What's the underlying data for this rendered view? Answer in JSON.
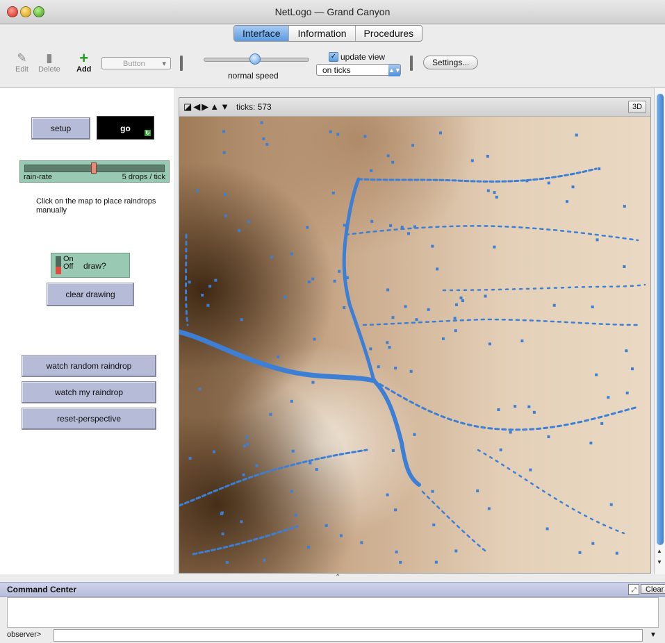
{
  "window": {
    "title": "NetLogo — Grand Canyon"
  },
  "tabs": [
    "Interface",
    "Information",
    "Procedures"
  ],
  "active_tab": "Interface",
  "toolbar": {
    "edit_label": "Edit",
    "delete_label": "Delete",
    "add_label": "Add",
    "widget_type": "Button",
    "speed_label": "normal speed",
    "speed_fraction": 0.5,
    "update_view_label": "update view",
    "update_view_checked": true,
    "update_mode": "on ticks",
    "settings_label": "Settings..."
  },
  "left_panel": {
    "setup_label": "setup",
    "go_label": "go",
    "rain_rate": {
      "label": "rain-rate",
      "value_text": "5 drops / tick",
      "fraction": 0.5
    },
    "note": "Click on the map to place raindrops manually",
    "switch": {
      "on_label": "On",
      "off_label": "Off",
      "label": "draw?",
      "state": "off"
    },
    "clear_drawing_label": "clear drawing",
    "watch_random_label": "watch random raindrop",
    "watch_my_label": "watch my raindrop",
    "reset_perspective_label": "reset-perspective"
  },
  "view": {
    "ticks_text": "ticks: 573",
    "three_d_label": "3D",
    "raindrop_color": "#3d7fd4"
  },
  "command_center": {
    "title": "Command Center",
    "clear_label": "Clear",
    "observer_label": "observer>"
  },
  "colors": {
    "button_fill": "#b6bbd8",
    "slider_switch_fill": "#99c9b2",
    "tab_active": "#5c9be0"
  }
}
